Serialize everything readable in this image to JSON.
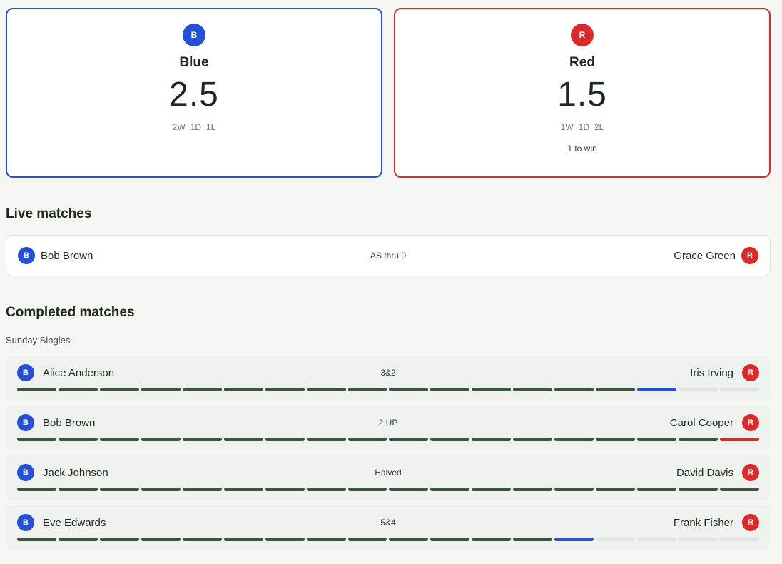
{
  "colors": {
    "blue": "#2350d6",
    "red": "#db2a2a",
    "played": "#3b5440",
    "unplayed": "#dfe4df"
  },
  "teams": {
    "blue": {
      "badge": "B",
      "name": "Blue",
      "score": "2.5",
      "wins": "2W",
      "draws": "1D",
      "losses": "1L"
    },
    "red": {
      "badge": "R",
      "name": "Red",
      "score": "1.5",
      "wins": "1W",
      "draws": "1D",
      "losses": "2L",
      "note": "1 to win"
    }
  },
  "live": {
    "title": "Live matches",
    "matches": [
      {
        "blue_badge": "B",
        "blue_player": "Bob Brown",
        "status": "AS thru 0",
        "red_player": "Grace Green",
        "red_badge": "R"
      }
    ]
  },
  "completed": {
    "title": "Completed matches",
    "round": "Sunday Singles",
    "matches": [
      {
        "blue_badge": "B",
        "blue_player": "Alice Anderson",
        "result": "3&2",
        "red_player": "Iris Irving",
        "red_badge": "R",
        "holes": [
          "p",
          "p",
          "p",
          "p",
          "p",
          "p",
          "p",
          "p",
          "p",
          "p",
          "p",
          "p",
          "p",
          "p",
          "p",
          "b",
          "u",
          "u"
        ]
      },
      {
        "blue_badge": "B",
        "blue_player": "Bob Brown",
        "result": "2 UP",
        "red_player": "Carol Cooper",
        "red_badge": "R",
        "holes": [
          "p",
          "p",
          "p",
          "p",
          "p",
          "p",
          "p",
          "p",
          "p",
          "p",
          "p",
          "p",
          "p",
          "p",
          "p",
          "p",
          "p",
          "r"
        ]
      },
      {
        "blue_badge": "B",
        "blue_player": "Jack Johnson",
        "result": "Halved",
        "red_player": "David Davis",
        "red_badge": "R",
        "holes": [
          "p",
          "p",
          "p",
          "p",
          "p",
          "p",
          "p",
          "p",
          "p",
          "p",
          "p",
          "p",
          "p",
          "p",
          "p",
          "p",
          "p",
          "p"
        ]
      },
      {
        "blue_badge": "B",
        "blue_player": "Eve Edwards",
        "result": "5&4",
        "red_player": "Frank Fisher",
        "red_badge": "R",
        "holes": [
          "p",
          "p",
          "p",
          "p",
          "p",
          "p",
          "p",
          "p",
          "p",
          "p",
          "p",
          "p",
          "p",
          "b",
          "u",
          "u",
          "u",
          "u"
        ]
      }
    ]
  }
}
